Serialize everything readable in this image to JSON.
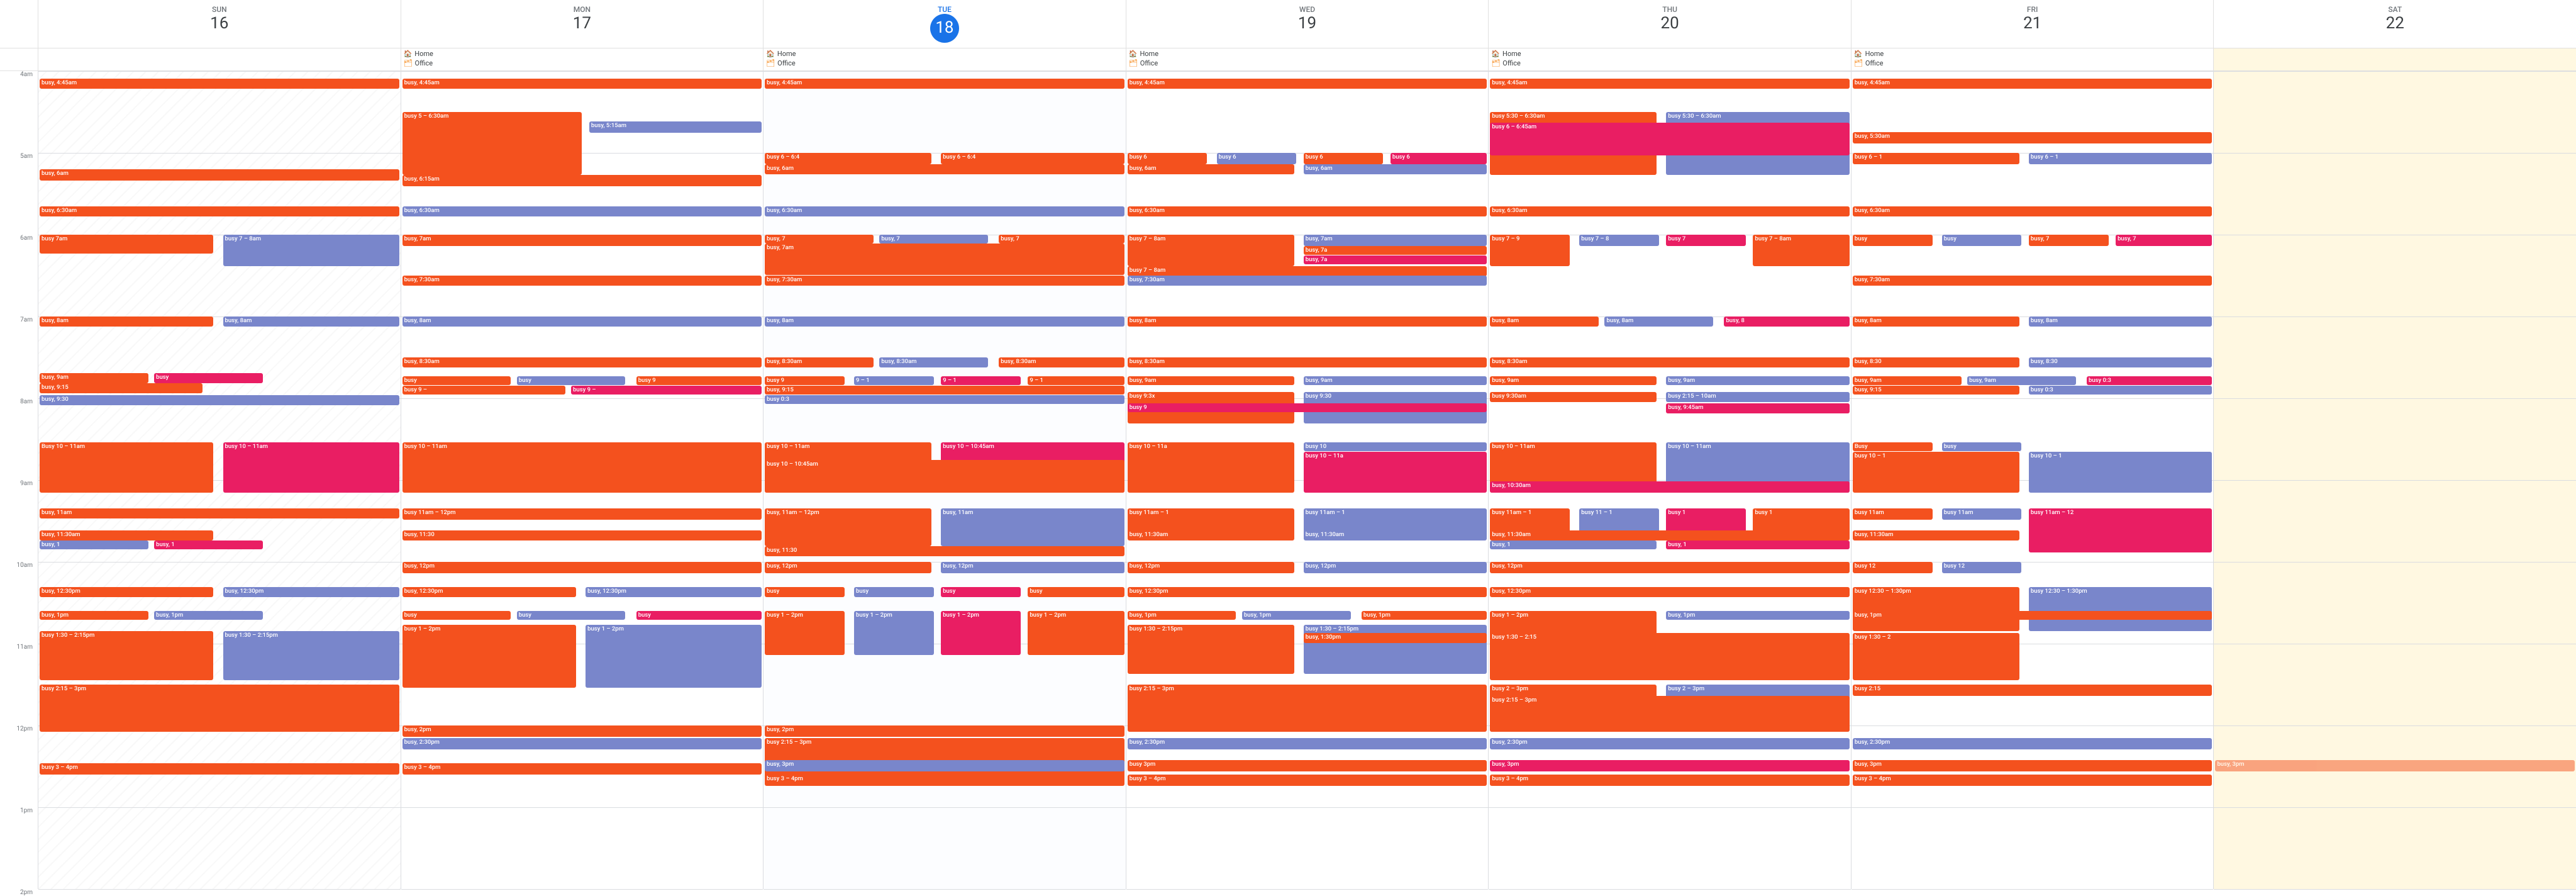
{
  "calendar": {
    "week": {
      "days": [
        {
          "name": "SUN",
          "num": "16",
          "today": false
        },
        {
          "name": "MON",
          "num": "17",
          "today": false
        },
        {
          "name": "TUE",
          "num": "18",
          "today": true
        },
        {
          "name": "WED",
          "num": "19",
          "today": false
        },
        {
          "name": "THU",
          "num": "20",
          "today": false
        },
        {
          "name": "FRI",
          "num": "21",
          "today": false
        },
        {
          "name": "SAT",
          "num": "22",
          "today": false
        }
      ],
      "locations": [
        {
          "home": "",
          "office": ""
        },
        {
          "home": "Home",
          "office": "Office"
        },
        {
          "home": "Home",
          "office": "Office"
        },
        {
          "home": "Home",
          "office": "Office"
        },
        {
          "home": "Home",
          "office": "Office"
        },
        {
          "home": "Home",
          "office": "Office"
        },
        {
          "home": "",
          "office": ""
        }
      ]
    }
  }
}
